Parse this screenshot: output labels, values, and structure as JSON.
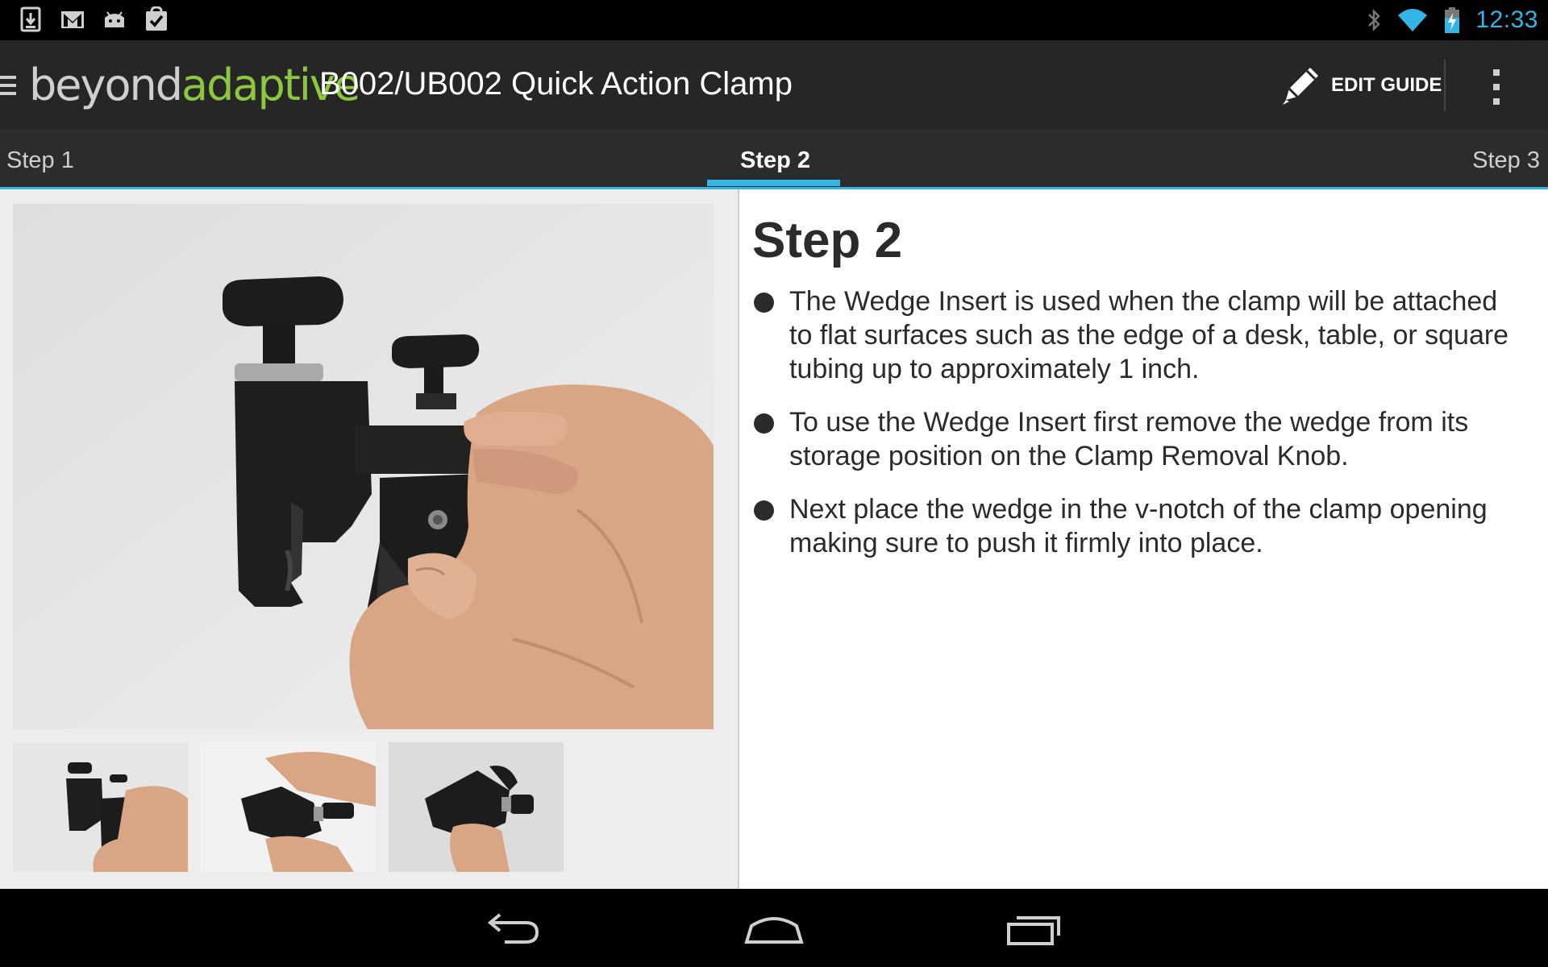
{
  "status_bar": {
    "clock": "12:33",
    "notification_icons": [
      "download-icon",
      "gmail-icon",
      "android-icon",
      "task-check-icon"
    ],
    "system_icons": [
      "bluetooth-icon",
      "wifi-icon",
      "battery-charging-icon"
    ],
    "clock_color": "#33b5e5"
  },
  "action_bar": {
    "logo_part1": "beyond",
    "logo_part2": "adaptive",
    "title": "B002/UB002 Quick Action Clamp",
    "edit_guide_label": "EDIT GUIDE",
    "logo_accent_color": "#8dc63f"
  },
  "tabs": [
    {
      "label": "Step 1",
      "selected": false
    },
    {
      "label": "Step 2",
      "selected": true
    },
    {
      "label": "Step 3",
      "selected": false
    }
  ],
  "accent_color": "#33b5e5",
  "step": {
    "heading": "Step 2",
    "bullets": [
      "The Wedge Insert is used when the clamp will be attached to flat surfaces such as the edge of a desk, table, or square tubing up to approximately 1 inch.",
      "To use the Wedge Insert first remove the wedge from its storage position on the Clamp Removal Knob.",
      "Next place the wedge in the v-notch of the clamp opening making sure to push it firmly into place."
    ]
  },
  "nav_bar": {
    "buttons": [
      "back-icon",
      "home-icon",
      "recent-apps-icon"
    ]
  }
}
